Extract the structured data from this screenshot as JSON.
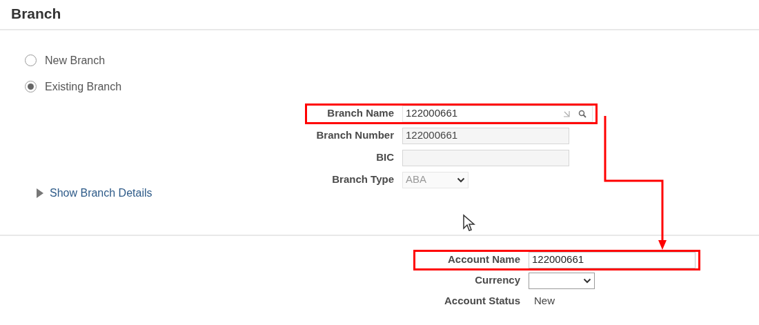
{
  "title": "Branch",
  "branch_options": [
    {
      "label": "New Branch",
      "selected": false
    },
    {
      "label": "Existing Branch",
      "selected": true
    }
  ],
  "branch_fields": [
    {
      "label": "Branch Name",
      "kind": "lookup",
      "value": "122000661",
      "highlighted": true,
      "disabled": false
    },
    {
      "label": "Branch Number",
      "kind": "text",
      "value": "122000661",
      "highlighted": false,
      "disabled": true
    },
    {
      "label": "BIC",
      "kind": "text",
      "highlighted": false,
      "disabled": true
    },
    {
      "label": "Branch Type",
      "kind": "select",
      "value": "ABA",
      "highlighted": false,
      "disabled": true
    }
  ],
  "details_link": {
    "label": "Show Branch Details",
    "expanded": false
  },
  "account_fields": [
    {
      "label": "Account Name",
      "kind": "text",
      "value": "122000661",
      "highlighted": true
    },
    {
      "label": "Currency",
      "kind": "select",
      "highlighted": false
    },
    {
      "label": "Account Status",
      "kind": "readonly",
      "value": "New",
      "highlighted": false
    }
  ]
}
